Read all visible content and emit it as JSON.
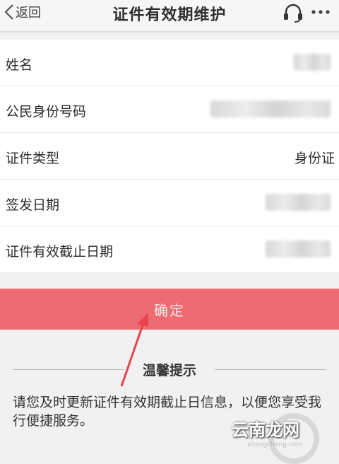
{
  "header": {
    "back_label": "返回",
    "title": "证件有效期维护"
  },
  "form": {
    "rows": [
      {
        "label": "姓名",
        "value": ""
      },
      {
        "label": "公民身份号码",
        "value": ""
      },
      {
        "label": "证件类型",
        "value": "身份证"
      },
      {
        "label": "签发日期",
        "value": ""
      },
      {
        "label": "证件有效截止日期",
        "value": ""
      }
    ]
  },
  "confirm_label": "确定",
  "tip": {
    "title": "温馨提示",
    "text": "请您及时更新证件有效期截止日信息，以便您享受我行便捷服务。"
  },
  "watermark": {
    "text": "云南龙网",
    "url": "xitongcheng.com"
  },
  "colors": {
    "confirm_bg": "#ed6b72",
    "arrow": "#e8434e"
  }
}
